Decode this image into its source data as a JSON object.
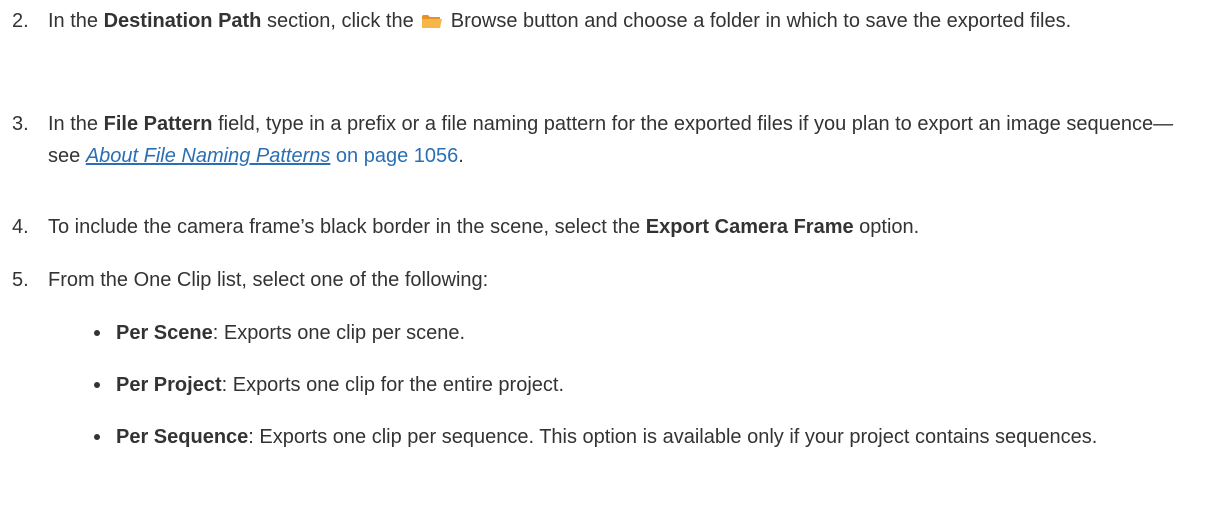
{
  "steps": [
    {
      "number": "2.",
      "pre": "In the ",
      "bold": "Destination Path",
      "mid": " section, click the ",
      "icon": "folder-icon",
      "post": " Browse button and choose a folder in which to save the exported files."
    },
    {
      "number": "3.",
      "pre": "In the ",
      "bold": "File Pattern",
      "post": " field, type in a prefix or a file naming pattern for the exported files if you plan to export an image sequence—see ",
      "link": "About File Naming Patterns",
      "link_suffix": " on page 1056",
      "end": "."
    },
    {
      "number": "4.",
      "pre": "To include the camera frame’s black border in the scene, select the ",
      "bold": "Export Camera Frame",
      "post": " option."
    },
    {
      "number": "5.",
      "text": "From the One Clip list, select one of the following:"
    }
  ],
  "bullets": [
    {
      "bold": "Per Scene",
      "text": ": Exports one clip per scene."
    },
    {
      "bold": "Per Project",
      "text": ": Exports one clip for the entire project."
    },
    {
      "bold": "Per Sequence",
      "text": ": Exports one clip per sequence. This option is available only if your project contains sequences."
    }
  ],
  "colors": {
    "text": "#333333",
    "link": "#2a6fb5",
    "folder_icon": "#f5a623"
  }
}
